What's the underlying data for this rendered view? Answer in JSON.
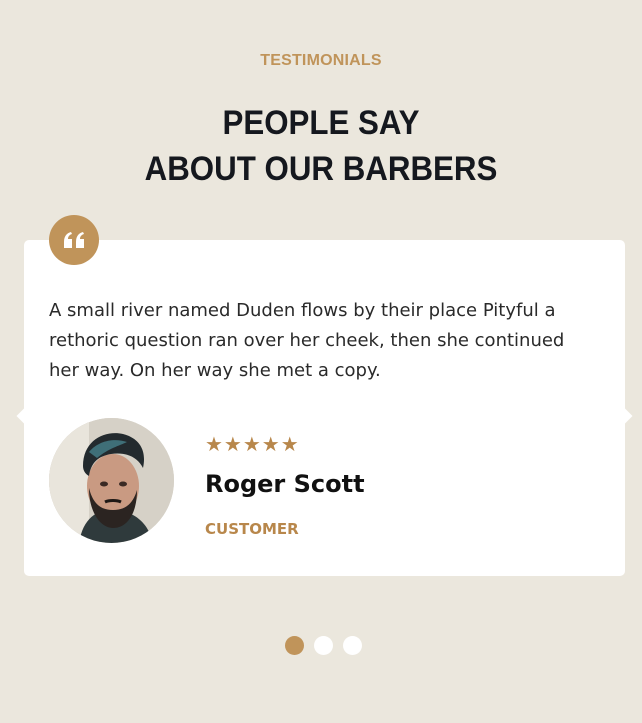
{
  "section": {
    "eyebrow": "TESTIMONIALS",
    "heading_line1": "PEOPLE SAY",
    "heading_line2": "ABOUT OUR BARBERS"
  },
  "testimonial": {
    "quote_icon": "quote-icon",
    "text": "A small river named Duden flows by their place Pityful a rethoric question ran over her cheek, then she continued her way. On her way she met a copy.",
    "rating": 5,
    "stars": "★★★★★",
    "name": "Roger Scott",
    "role": "CUSTOMER",
    "avatar_icon": "avatar"
  },
  "pagination": {
    "count": 3,
    "active_index": 0
  },
  "colors": {
    "background": "#ebe7dd",
    "accent": "#c0945a",
    "heading": "#15181e",
    "card": "#ffffff"
  }
}
